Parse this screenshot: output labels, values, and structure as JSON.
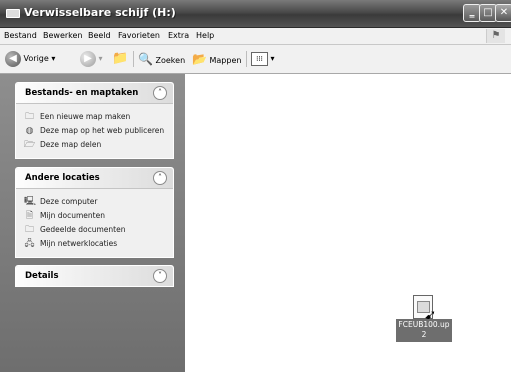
{
  "window": {
    "title": "Verwisselbare schijf (H:)",
    "controls": {
      "minimize": "‗",
      "maximize": "□",
      "close": "✕"
    }
  },
  "menu": [
    "Bestand",
    "Bewerken",
    "Beeld",
    "Favorieten",
    "Extra",
    "Help"
  ],
  "toolbar": {
    "back": "Vorige",
    "back_arrow": "▾",
    "search": "Zoeken",
    "folders": "Mappen",
    "views_arrow": "▾"
  },
  "panels": {
    "tasks": {
      "title": "Bestands- en maptaken",
      "toggle": "˄",
      "items": [
        "Een nieuwe map maken",
        "Deze map op het web publiceren",
        "Deze map delen"
      ]
    },
    "places": {
      "title": "Andere locaties",
      "toggle": "˄",
      "items": [
        "Deze computer",
        "Mijn documenten",
        "Gedeelde documenten",
        "Mijn netwerklocaties"
      ]
    },
    "details": {
      "title": "Details",
      "toggle": "˅"
    }
  },
  "file": {
    "name_line1": "FCEUB100.up",
    "name_line2": "2"
  },
  "icons": {
    "back": "back-arrow-icon",
    "forward": "forward-arrow-icon",
    "up": "folder-up-icon",
    "search": "search-icon",
    "folders": "folders-icon",
    "views": "views-icon"
  }
}
